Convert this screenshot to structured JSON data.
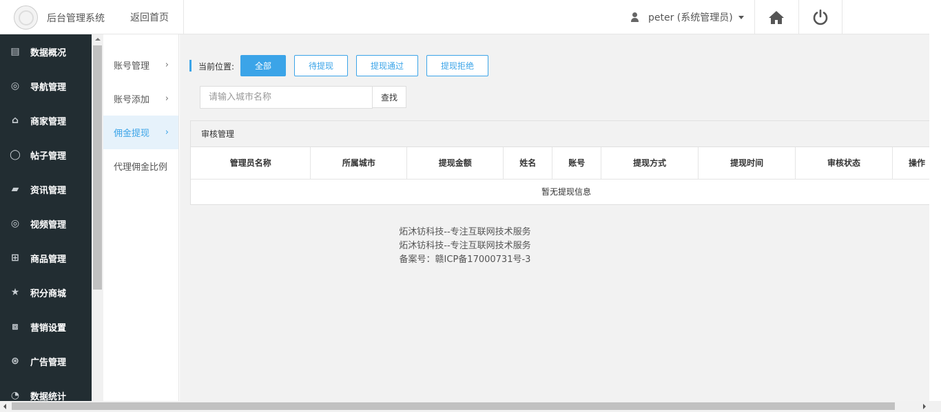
{
  "header": {
    "app_title": "后台管理系统",
    "home_link": "返回首页",
    "user": "peter (系统管理员)"
  },
  "sidenav": {
    "items": [
      {
        "label": "数据概况",
        "icon": "▤",
        "name": "dashboard"
      },
      {
        "label": "导航管理",
        "icon": "◎",
        "name": "navigation"
      },
      {
        "label": "商家管理",
        "icon": "⌂",
        "name": "merchant"
      },
      {
        "label": "帖子管理",
        "icon": "◯",
        "name": "posts"
      },
      {
        "label": "资讯管理",
        "icon": "▰",
        "name": "news"
      },
      {
        "label": "视频管理",
        "icon": "◎",
        "name": "video"
      },
      {
        "label": "商品管理",
        "icon": "⊞",
        "name": "products"
      },
      {
        "label": "积分商城",
        "icon": "★",
        "name": "points-mall"
      },
      {
        "label": "营销设置",
        "icon": "⧈",
        "name": "marketing"
      },
      {
        "label": "广告管理",
        "icon": "⊛",
        "name": "ads"
      },
      {
        "label": "数据统计",
        "icon": "◔",
        "name": "statistics"
      }
    ]
  },
  "submenu": {
    "items": [
      {
        "label": "账号管理",
        "arrow": "›",
        "active": false
      },
      {
        "label": "账号添加",
        "arrow": "›",
        "active": false
      },
      {
        "label": "佣金提现",
        "arrow": "›",
        "active": true
      },
      {
        "label": "代理佣金比例",
        "arrow": "",
        "active": false
      }
    ]
  },
  "main": {
    "crumb_label": "当前位置:",
    "filters": [
      {
        "label": "全部",
        "active": true
      },
      {
        "label": "待提现",
        "active": false
      },
      {
        "label": "提现通过",
        "active": false
      },
      {
        "label": "提现拒绝",
        "active": false
      }
    ],
    "search": {
      "placeholder": "请输入城市名称",
      "button": "查找"
    },
    "panel_title": "审核管理",
    "table": {
      "columns": [
        "管理员名称",
        "所属城市",
        "提现金额",
        "姓名",
        "账号",
        "提现方式",
        "提现时间",
        "审核状态",
        "操作"
      ],
      "empty_text": "暂无提现信息"
    },
    "footer": [
      "炻沐钫科技--专注互联网技术服务",
      "炻沐钫科技--专注互联网技术服务",
      "备案号：赣ICP备17000731号-3"
    ]
  },
  "colors": {
    "accent": "#3ba4e8",
    "sidebar_bg": "#222d32"
  }
}
